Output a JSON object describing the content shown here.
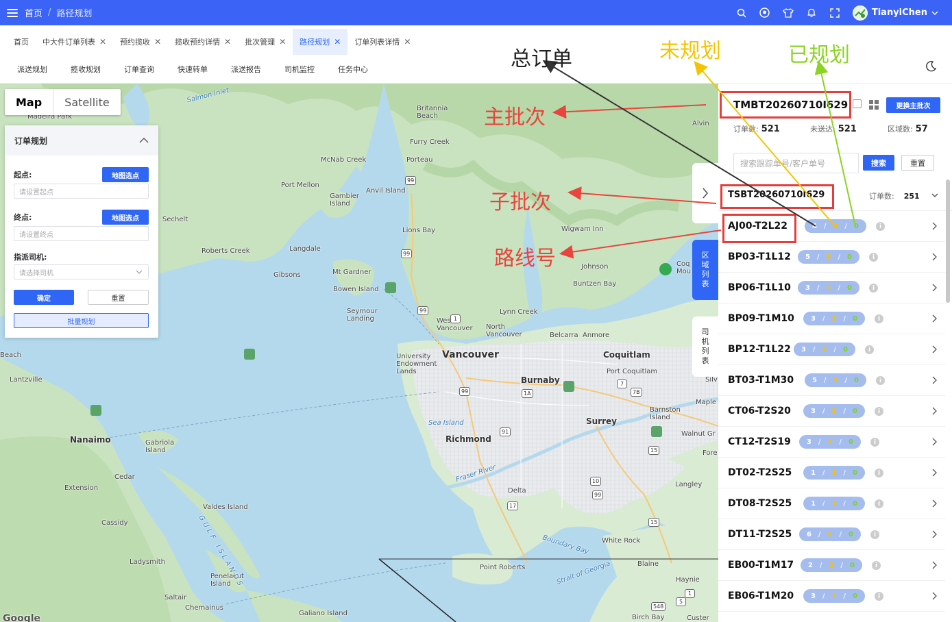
{
  "topbar": {
    "home": "首页",
    "sep": "/",
    "current": "路径规划",
    "user": "TianyiChen"
  },
  "tabs": [
    {
      "label": "首页",
      "closable": false,
      "active": false
    },
    {
      "label": "中大件订单列表",
      "closable": true,
      "active": false
    },
    {
      "label": "预约揽收",
      "closable": true,
      "active": false
    },
    {
      "label": "揽收预约详情",
      "closable": true,
      "active": false
    },
    {
      "label": "批次管理",
      "closable": true,
      "active": false
    },
    {
      "label": "路径规划",
      "closable": true,
      "active": true
    },
    {
      "label": "订单列表详情",
      "closable": true,
      "active": false
    }
  ],
  "subnav": [
    "派送规划",
    "揽收规划",
    "订单查询",
    "快速转单",
    "派送报告",
    "司机监控",
    "任务中心"
  ],
  "map": {
    "type_map": "Map",
    "type_satellite": "Satellite",
    "labels": [
      {
        "t": "Salmon Inlet",
        "k": "water"
      },
      {
        "t": "Madeira Park"
      },
      {
        "t": "Britannia\nBeach"
      },
      {
        "t": "Alvin"
      },
      {
        "t": "Furry Creek"
      },
      {
        "t": "McNab Creek"
      },
      {
        "t": "Porteau"
      },
      {
        "t": "Port Mellon"
      },
      {
        "t": "Gambier\nIsland"
      },
      {
        "t": "Anvil Island"
      },
      {
        "t": "Sechelt"
      },
      {
        "t": "Lions Bay"
      },
      {
        "t": "Wigwam Inn"
      },
      {
        "t": "Langdale"
      },
      {
        "t": "Roberts Creek"
      },
      {
        "t": "Gibsons"
      },
      {
        "t": "Mt Gardner"
      },
      {
        "t": "Johnson"
      },
      {
        "t": "Buntzen Bay"
      },
      {
        "t": "Bowen Island"
      },
      {
        "t": "Seymour\nLanding"
      },
      {
        "t": "Lynn Creek"
      },
      {
        "t": "West\nVancouver"
      },
      {
        "t": "North\nVancouver"
      },
      {
        "t": "Belcarra"
      },
      {
        "t": "Anmore"
      },
      {
        "t": "Beach"
      },
      {
        "t": "University\nEndowment\nLands"
      },
      {
        "t": "Vancouver",
        "k": "big"
      },
      {
        "t": "Coquitlam",
        "k": "mid"
      },
      {
        "t": "Lantzville"
      },
      {
        "t": "Port Coquitlam"
      },
      {
        "t": "Burnaby",
        "k": "mid"
      },
      {
        "t": "Silv"
      },
      {
        "t": "Maple"
      },
      {
        "t": "Barnston\nIsland"
      },
      {
        "t": "Sea Island",
        "k": "water"
      },
      {
        "t": "Surrey",
        "k": "mid"
      },
      {
        "t": "Walnut Gr"
      },
      {
        "t": "Nanaimo",
        "k": "mid"
      },
      {
        "t": "Gabriola\nIsland"
      },
      {
        "t": "Richmond",
        "k": "mid"
      },
      {
        "t": "Fore"
      },
      {
        "t": "Cedar"
      },
      {
        "t": "Extension"
      },
      {
        "t": "Fraser River",
        "k": "water"
      },
      {
        "t": "Delta"
      },
      {
        "t": "Langley"
      },
      {
        "t": "Valdes Island"
      },
      {
        "t": "Cassidy"
      },
      {
        "t": "Boundary Bay",
        "k": "water"
      },
      {
        "t": "White Rock"
      },
      {
        "t": "Ladysmith"
      },
      {
        "t": "Blaine"
      },
      {
        "t": "Point Roberts"
      },
      {
        "t": "Penelakut\nIsland"
      },
      {
        "t": "Strait of Georgia",
        "k": "water"
      },
      {
        "t": "Haynie"
      },
      {
        "t": "Saltair"
      },
      {
        "t": "Chemainus"
      },
      {
        "t": "Galiano Island"
      },
      {
        "t": "Birch Bay"
      },
      {
        "t": "Custer"
      },
      {
        "t": "Coq\nMou"
      },
      {
        "t": "GULF ISLANDS",
        "k": "water"
      },
      {
        "t": "Google"
      }
    ],
    "highway_shields": [
      "99",
      "99",
      "99",
      "1",
      "99",
      "1A",
      "7",
      "7B",
      "91",
      "15",
      "10",
      "99",
      "17",
      "15",
      "548",
      "5",
      "1"
    ]
  },
  "planner": {
    "title": "订单规划",
    "start_label": "起点:",
    "start_btn": "地图选点",
    "start_placeholder": "请设置起点",
    "end_label": "终点:",
    "end_btn": "地图选点",
    "end_placeholder": "请设置终点",
    "driver_label": "指派司机:",
    "driver_placeholder": "请选择司机",
    "confirm": "确定",
    "reset": "重置",
    "batch": "批量规划"
  },
  "side_tabs": {
    "region": "区域列表",
    "driver": "司机列表"
  },
  "right": {
    "main_batch": "TMBT20260710I629",
    "switch_btn": "更换主批次",
    "stats": [
      {
        "label": "订单数:",
        "value": "521"
      },
      {
        "label": "未送达:",
        "value": "521"
      },
      {
        "label": "区域数:",
        "value": "57"
      }
    ],
    "search_placeholder": "搜索跟踪单号/客户单号",
    "search_btn": "搜索",
    "reset_btn": "重置",
    "sub_batch": "TSBT20260710I629",
    "sub_count_label": "订单数:",
    "sub_count": "251",
    "routes": [
      {
        "code": "AJ00-T2L22",
        "a": "4",
        "b": "4",
        "c": "0"
      },
      {
        "code": "BP03-T1L12",
        "a": "5",
        "b": "5",
        "c": "0"
      },
      {
        "code": "BP06-T1L10",
        "a": "3",
        "b": "3",
        "c": "0"
      },
      {
        "code": "BP09-T1M10",
        "a": "3",
        "b": "3",
        "c": "0"
      },
      {
        "code": "BP12-T1L22",
        "a": "3",
        "b": "3",
        "c": "0"
      },
      {
        "code": "BT03-T1M30",
        "a": "5",
        "b": "5",
        "c": "0"
      },
      {
        "code": "CT06-T2S20",
        "a": "3",
        "b": "3",
        "c": "0"
      },
      {
        "code": "CT12-T2S19",
        "a": "3",
        "b": "3",
        "c": "0"
      },
      {
        "code": "DT02-T2S25",
        "a": "1",
        "b": "1",
        "c": "0"
      },
      {
        "code": "DT08-T2S25",
        "a": "1",
        "b": "1",
        "c": "0"
      },
      {
        "code": "DT11-T2S25",
        "a": "6",
        "b": "6",
        "c": "0"
      },
      {
        "code": "EB00-T1M17",
        "a": "2",
        "b": "2",
        "c": "0"
      },
      {
        "code": "EB06-T1M20",
        "a": "3",
        "b": "3",
        "c": "0"
      }
    ]
  },
  "annotations": {
    "main_batch": "主批次",
    "sub_batch": "子批次",
    "route_no": "路线号",
    "total_orders": "总订单",
    "unplanned": "未规划",
    "planned": "已规划"
  },
  "colors": {
    "brand": "#3b63f5",
    "annotation_red": "#e8453c",
    "annotation_yellow": "#f5c400",
    "annotation_green": "#8bd422",
    "pill": "#a5bcef"
  }
}
